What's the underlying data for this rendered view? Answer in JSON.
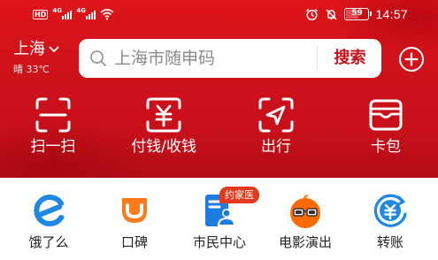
{
  "status_bar": {
    "hd": "HD",
    "signal_label": "4G",
    "time": "14:57",
    "battery": "59",
    "battery_level_percent": 59
  },
  "location": {
    "city": "上海",
    "weather": "晴 33℃"
  },
  "search": {
    "placeholder": "上海市随申码",
    "button": "搜索"
  },
  "top_actions": [
    {
      "label": "扫一扫",
      "icon": "scan-icon"
    },
    {
      "label": "付钱/收钱",
      "icon": "pay-icon"
    },
    {
      "label": "出行",
      "icon": "travel-icon"
    },
    {
      "label": "卡包",
      "icon": "card-wallet-icon"
    }
  ],
  "services": [
    {
      "label": "饿了么",
      "icon": "eleme-icon"
    },
    {
      "label": "口碑",
      "icon": "koubei-icon"
    },
    {
      "label": "市民中心",
      "icon": "citizen-center-icon",
      "badge": "约家医"
    },
    {
      "label": "电影演出",
      "icon": "movie-show-icon"
    },
    {
      "label": "转账",
      "icon": "transfer-icon"
    }
  ],
  "colors": {
    "header_red": "#d0121a",
    "search_button": "#c8101a",
    "service_blue": "#1e88e5",
    "service_orange": "#ff6a00",
    "badge_red": "#e23a1d"
  }
}
